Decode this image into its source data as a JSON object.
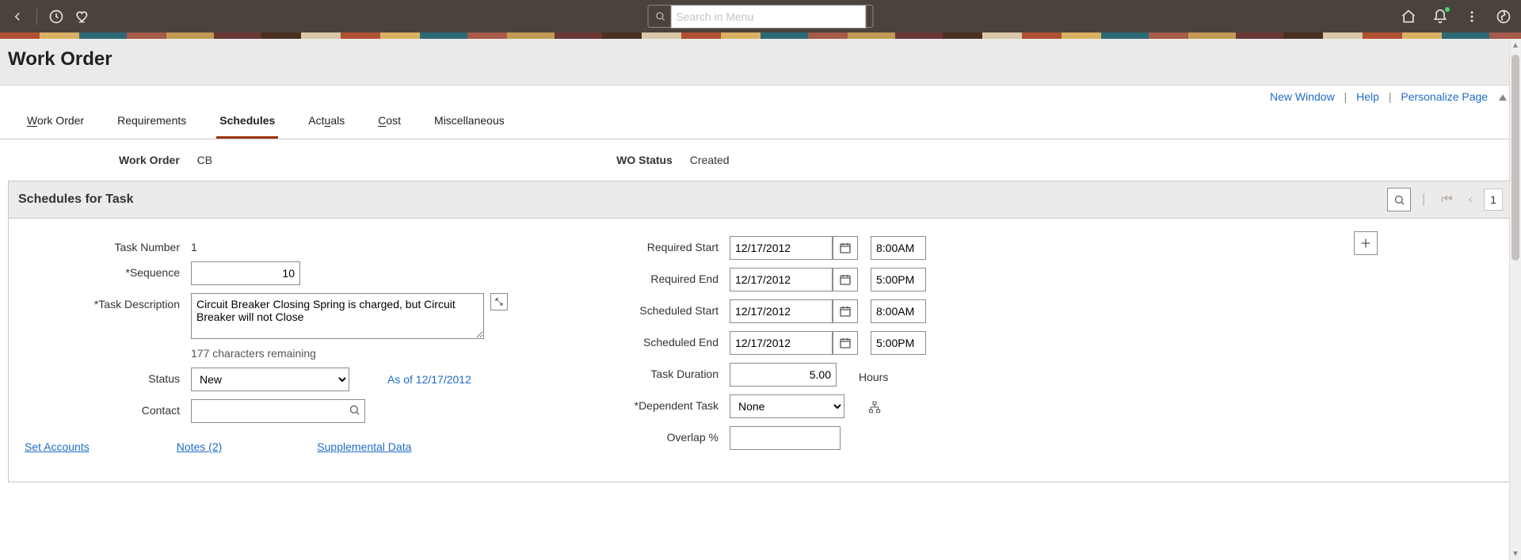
{
  "topbar": {
    "search_placeholder": "Search in Menu"
  },
  "page": {
    "title": "Work Order"
  },
  "links": {
    "new_window": "New Window",
    "help": "Help",
    "personalize": "Personalize Page"
  },
  "tabs": {
    "work_order": "Work Order",
    "requirements": "Requirements",
    "schedules": "Schedules",
    "actuals": "Actuals",
    "cost": "Cost",
    "misc": "Miscellaneous"
  },
  "header": {
    "wo_label": "Work Order",
    "wo_value": "CB",
    "status_label": "WO Status",
    "status_value": "Created"
  },
  "grid": {
    "title": "Schedules for Task",
    "page": "1"
  },
  "left": {
    "task_number_label": "Task Number",
    "task_number_value": "1",
    "sequence_label": "Sequence",
    "sequence_value": "10",
    "desc_label": "Task Description",
    "desc_value": "Circuit Breaker Closing Spring is charged, but Circuit Breaker will not Close",
    "desc_remaining": "177 characters remaining",
    "status_label": "Status",
    "status_value": "New",
    "asof": "As of 12/17/2012",
    "contact_label": "Contact",
    "contact_value": "",
    "set_accounts": "Set Accounts",
    "notes": "Notes (2)",
    "supplemental": "Supplemental Data"
  },
  "right": {
    "req_start_label": "Required Start",
    "req_start_date": "12/17/2012",
    "req_start_time": "8:00AM",
    "req_end_label": "Required End",
    "req_end_date": "12/17/2012",
    "req_end_time": "5:00PM",
    "sch_start_label": "Scheduled Start",
    "sch_start_date": "12/17/2012",
    "sch_start_time": "8:00AM",
    "sch_end_label": "Scheduled End",
    "sch_end_date": "12/17/2012",
    "sch_end_time": "5:00PM",
    "duration_label": "Task Duration",
    "duration_value": "5.00",
    "duration_unit": "Hours",
    "dep_label": "Dependent Task",
    "dep_value": "None",
    "overlap_label": "Overlap %",
    "overlap_value": ""
  }
}
